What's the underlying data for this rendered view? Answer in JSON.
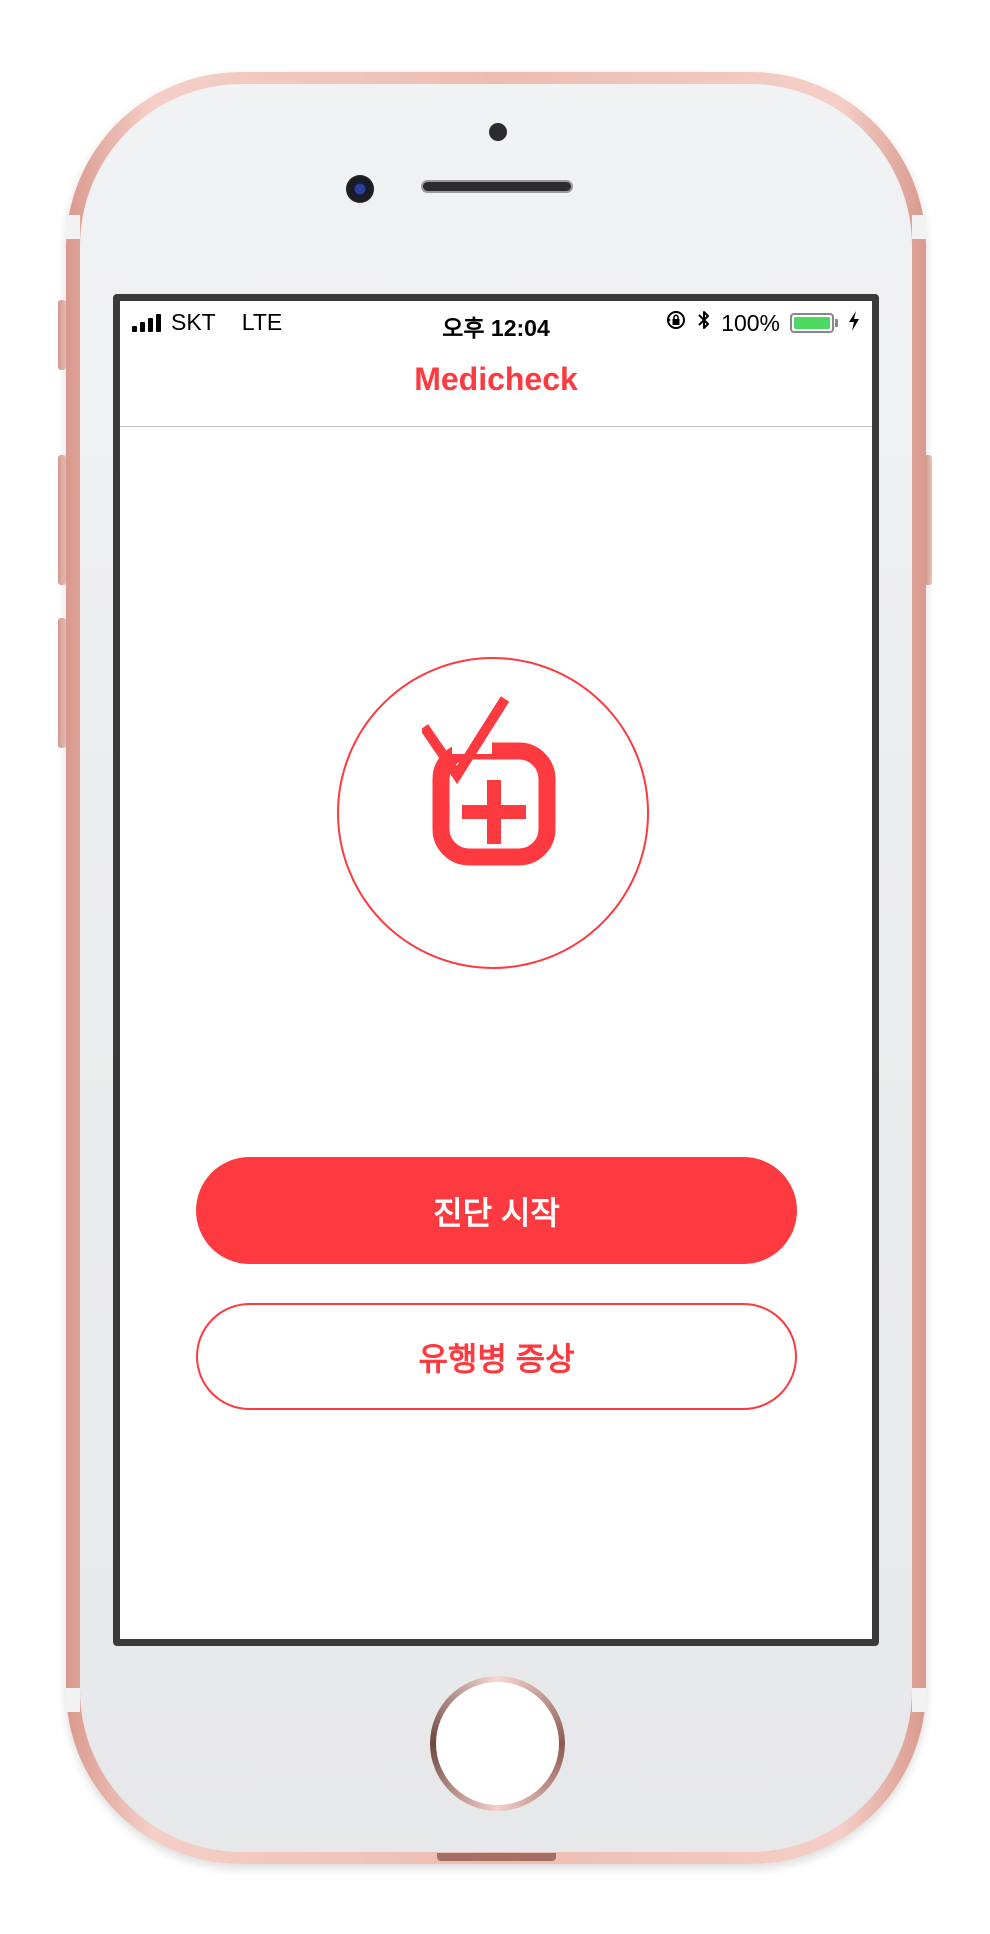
{
  "colors": {
    "accent": "#fc3a3f",
    "battery": "#4cd964"
  },
  "status_bar": {
    "carrier": "SKT",
    "network": "LTE",
    "time": "오후 12:04",
    "battery_percent": "100%",
    "battery_level": 1.0,
    "icons": [
      "signal-bars-icon",
      "rotation-lock-icon",
      "bluetooth-icon",
      "battery-icon",
      "charging-bolt-icon"
    ]
  },
  "nav": {
    "title": "Medicheck"
  },
  "logo": {
    "icon": "medical-check-icon"
  },
  "actions": {
    "start_label": "진단 시작",
    "epidemic_label": "유행병 증상"
  }
}
